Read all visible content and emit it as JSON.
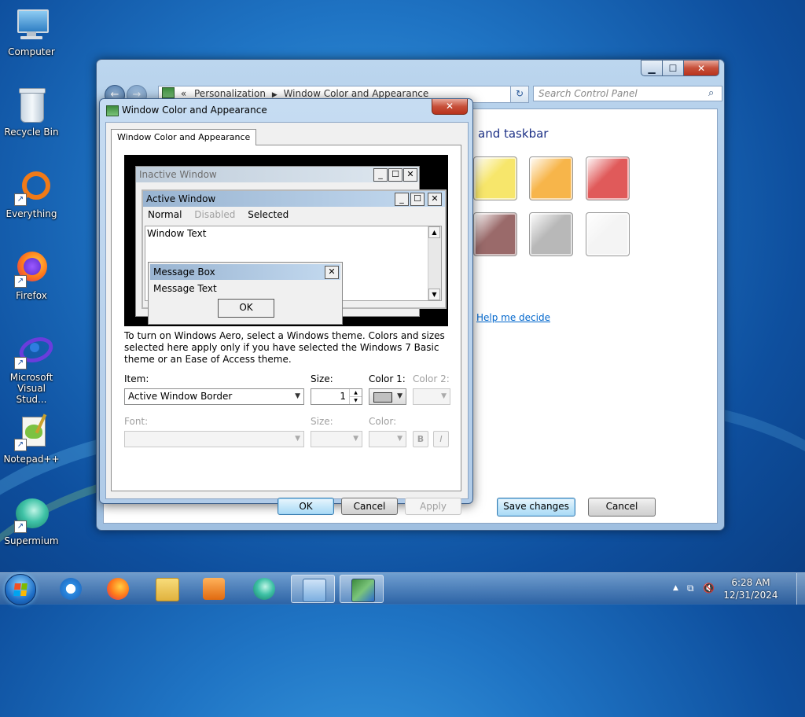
{
  "desktop": {
    "icons": [
      {
        "label": "Computer"
      },
      {
        "label": "Recycle Bin"
      },
      {
        "label": "Everything"
      },
      {
        "label": "Firefox"
      },
      {
        "label": "Microsoft Visual Stud..."
      },
      {
        "label": "Notepad++"
      },
      {
        "label": "Supermium"
      }
    ]
  },
  "control_panel": {
    "breadcrumb": {
      "prefix": "«",
      "items": [
        "Personalization",
        "Window Color and Appearance"
      ]
    },
    "search_placeholder": "Search Control Panel",
    "heading_fragment": "and taskbar",
    "help_link": "Help me decide",
    "save_button": "Save changes",
    "cancel_button": "Cancel",
    "swatch_colors": [
      "#f7e66b",
      "#f7b54a",
      "#e05a5a",
      "#9a6a6a",
      "#b8b8b8",
      "#f4f4f4"
    ]
  },
  "dialog": {
    "title": "Window Color and Appearance",
    "close_glyph": "✕",
    "tab_label": "Window Color and Appearance",
    "preview": {
      "inactive_title": "Inactive Window",
      "active_title": "Active Window",
      "menu": [
        "Normal",
        "Disabled",
        "Selected"
      ],
      "window_text": "Window Text",
      "message_box_title": "Message Box",
      "message_text": "Message Text",
      "ok": "OK"
    },
    "info_text": "To turn on Windows Aero, select a Windows theme.  Colors and sizes selected here apply only if you have selected the Windows 7 Basic theme or an Ease of Access theme.",
    "item_label": "Item:",
    "item_value": "Active Window Border",
    "size_label": "Size:",
    "size_value": "1",
    "color1_label": "Color 1:",
    "color1_value": "#c0c0c0",
    "color2_label": "Color 2:",
    "font_label": "Font:",
    "font_size_label": "Size:",
    "font_color_label": "Color:",
    "bold_label": "B",
    "italic_label": "I",
    "ok_button": "OK",
    "cancel_button": "Cancel",
    "apply_button": "Apply"
  },
  "taskbar": {
    "items": [
      "internet-explorer",
      "firefox",
      "file-explorer",
      "media-player",
      "supermium",
      "control-panel",
      "window-color"
    ],
    "time": "6:28 AM",
    "date": "12/31/2024"
  }
}
